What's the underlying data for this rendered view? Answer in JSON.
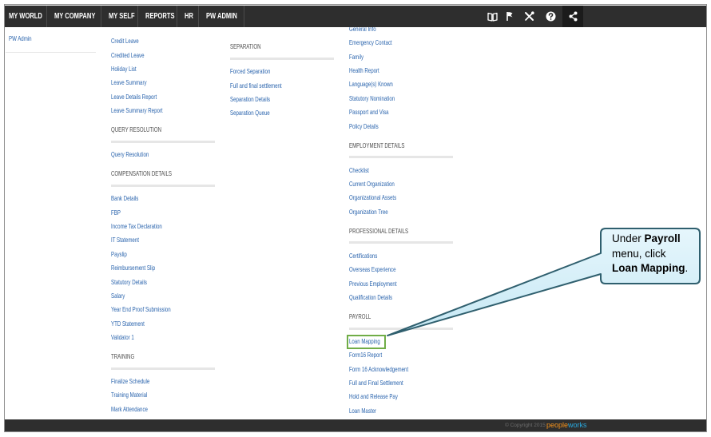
{
  "nav": {
    "items": [
      "MY WORLD",
      "MY COMPANY",
      "MY SELF",
      "REPORTS",
      "HR",
      "PW ADMIN"
    ],
    "icons": [
      "book-icon",
      "flag-icon",
      "tools-icon",
      "help-icon",
      "share-icon"
    ]
  },
  "sidebar": {
    "title": "PW Admin"
  },
  "columns": [
    {
      "sections": [
        {
          "items": [
            "Credit Leave",
            "Credited Leave",
            "Holiday List",
            "Leave Summary",
            "Leave Details Report",
            "Leave Summary Report"
          ]
        },
        {
          "header": "QUERY RESOLUTION",
          "items": [
            "Query Resolution"
          ]
        },
        {
          "header": "COMPENSATION DETAILS",
          "items": [
            "Bank Details",
            "FBP",
            "Income Tax Declaration",
            "IT Statement",
            "Payslip",
            "Reimbursement Slip",
            "Statutory Details",
            "Salary",
            "Year End Proof Submission",
            "YTD Statement",
            "Validator 1"
          ]
        },
        {
          "header": "TRAINING",
          "items": [
            "Finalize Schedule",
            "Training Material",
            "Mark Attendance"
          ]
        }
      ]
    },
    {
      "sections": [
        {
          "header": "SEPARATION",
          "items": [
            "Forced Separation",
            "Full and final settlement",
            "Separation Details",
            "Separation Queue"
          ]
        }
      ]
    },
    {
      "sections": [
        {
          "items": [
            "General Info",
            "Emergency Contact",
            "Family",
            "Health Report",
            "Language(s) Known",
            "Statutory Nomination",
            "Passport and Visa",
            "Policy Details"
          ]
        },
        {
          "header": "EMPLOYMENT DETAILS",
          "items": [
            "Checklist",
            "Current Organization",
            "Organizational Assets",
            "Organization Tree"
          ]
        },
        {
          "header": "PROFESSIONAL DETAILS",
          "items": [
            "Certifications",
            "Overseas Experience",
            "Previous Employment",
            "Qualification Details"
          ]
        },
        {
          "header": "PAYROLL",
          "items": [
            "Loan Mapping",
            "Form16 Report",
            "Form 16 Acknowledgement",
            "Full and Final Settlement",
            "Hold and Release Pay",
            "Loan Master"
          ]
        }
      ]
    }
  ],
  "callout": {
    "line1_prefix": "Under",
    "line1_bold": "Payroll",
    "line2": "menu, click",
    "line3_bold": "Loan Mapping",
    "line3_suffix": "."
  },
  "footer": {
    "copyright": "© Copyright 2015",
    "logo_part1": "people",
    "logo_part2": "works"
  },
  "colors": {
    "navbar": "#2e2e2e",
    "link": "#2a64ad",
    "section_header": "#4d4d4d",
    "highlight": "#70ad47",
    "callout_fill": "#d9f1f9",
    "callout_border": "#2f5f6e"
  }
}
